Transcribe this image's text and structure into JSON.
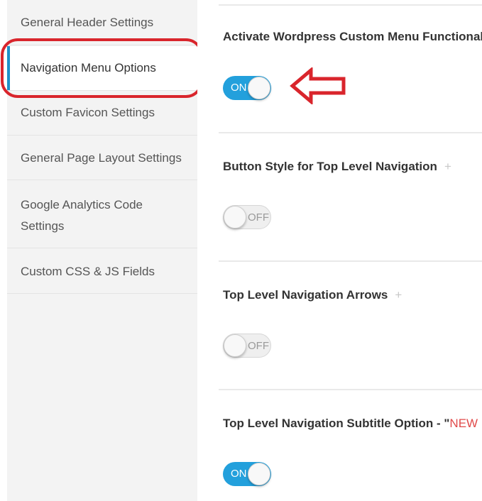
{
  "sidebar": {
    "items": [
      {
        "label": "General Header Settings"
      },
      {
        "label": "Navigation Menu Options"
      },
      {
        "label": "Custom Favicon Settings"
      },
      {
        "label": "General Page Layout Settings"
      },
      {
        "label": "Google Analytics Code Settings"
      },
      {
        "label": "Custom CSS & JS Fields"
      }
    ]
  },
  "options": [
    {
      "title": "Activate Wordpress Custom Menu Functionality",
      "toggle": "ON"
    },
    {
      "title": "Button Style for Top Level Navigation",
      "toggle": "OFF"
    },
    {
      "title": "Top Level Navigation Arrows",
      "toggle": "OFF"
    },
    {
      "title": "Top Level Navigation Subtitle Option - \"",
      "title_highlight": "NEW FEA",
      "toggle": "ON"
    }
  ],
  "icons": {
    "plus": "+",
    "annotation_arrow": "left-arrow-icon"
  },
  "colors": {
    "accent": "#23a0dc",
    "annotation": "#d9252c",
    "new_feature": "#e04a4a"
  }
}
